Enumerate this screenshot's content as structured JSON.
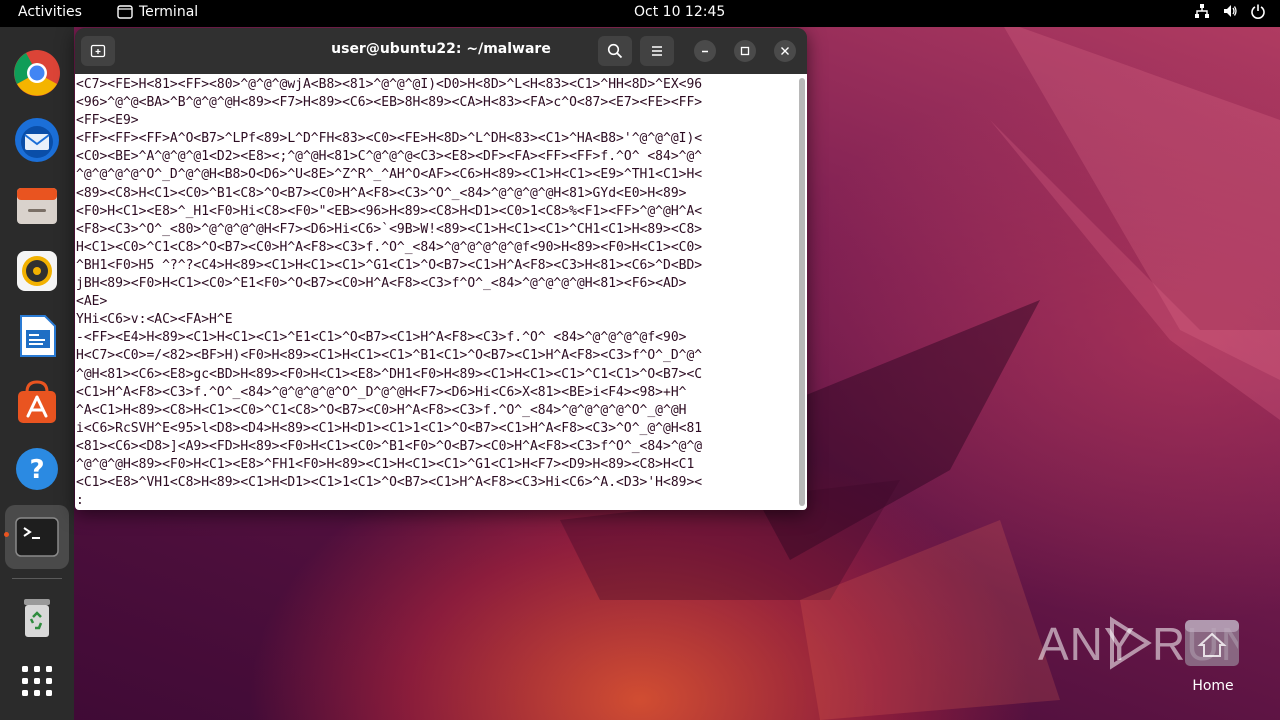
{
  "topbar": {
    "activities": "Activities",
    "app_name": "Terminal",
    "clock": "Oct 10  12:45"
  },
  "dock": {
    "items": [
      {
        "name": "Google Chrome",
        "icon": "chrome-icon"
      },
      {
        "name": "Thunderbird Mail",
        "icon": "thunderbird-icon"
      },
      {
        "name": "Files",
        "icon": "files-icon"
      },
      {
        "name": "Rhythmbox",
        "icon": "rhythmbox-icon"
      },
      {
        "name": "LibreOffice Writer",
        "icon": "writer-icon"
      },
      {
        "name": "Ubuntu Software",
        "icon": "software-icon"
      },
      {
        "name": "Help",
        "icon": "help-icon"
      },
      {
        "name": "Terminal",
        "icon": "terminal-icon",
        "running": true
      },
      {
        "name": "Trash",
        "icon": "trash-icon"
      },
      {
        "name": "Show Applications",
        "icon": "app-grid-icon"
      }
    ]
  },
  "terminal": {
    "title": "user@ubuntu22: ~/malware",
    "lines": [
      "<C7><FE>H<81><FF><80>^@^@^@wjA<B8><81>^@^@^@I)<D0>H<8D>^L<H<83><C1>^HH<8D>^EX<96",
      "<96>^@^@<BA>^B^@^@^@H<89><F7>H<89><C6><EB>8H<89><CA>H<83><FA>c^O<87><E7><FE><FF>",
      "<FF><E9>",
      "<FF><FF><FF>A^O<B7>^LPf<89>L^D^FH<83><C0><FE>H<8D>^L^DH<83><C1>^HA<B8>'^@^@^@I)<",
      "<C0><BE>^A^@^@^@1<D2><E8><;^@^@H<81>C^@^@^@<C3><E8><DF><FA><FF><FF>f.^O^ <84>^@^",
      "^@^@^@^@^O^_D^@^@H<B8>O<D6>^U<8E>^Z^R^_^AH^O<AF><C6>H<89><C1>H<C1><E9>^TH1<C1>H<",
      "<89><C8>H<C1><C0>^B1<C8>^O<B7><C0>H^A<F8><C3>^O^_<84>^@^@^@^@H<81>GYd<E0>H<89>",
      "<F0>H<C1><E8>^_H1<F0>Hi<C8><F0>\"<EB><96>H<89><C8>H<D1><C0>1<C8>%<F1><FF>^@^@H^A<",
      "<F8><C3>^O^_<80>^@^@^@^@H<F7><D6>Hi<C6>`<9B>W!<89><C1>H<C1><C1>^CH1<C1>H<89><C8>",
      "H<C1><C0>^C1<C8>^O<B7><C0>H^A<F8><C3>f.^O^_<84>^@^@^@^@^@f<90>H<89><F0>H<C1><C0>",
      "^BH1<F0>H5 ^?^?<C4>H<89><C1>H<C1><C1>^G1<C1>^O<B7><C1>H^A<F8><C3>H<81><C6>^D<BD>",
      "jBH<89><F0>H<C1><C0>^E1<F0>^O<B7><C0>H^A<F8><C3>f^O^_<84>^@^@^@^@H<81><F6><AD>",
      "<AE>",
      "YHi<C6>v:<AC><FA>H^E",
      "-<FF><E4>H<89><C1>H<C1><C1>^E1<C1>^O<B7><C1>H^A<F8><C3>f.^O^ <84>^@^@^@^@f<90>",
      "H<C7><C0>=/<82><BF>H)<F0>H<89><C1>H<C1><C1>^B1<C1>^O<B7><C1>H^A<F8><C3>f^O^_D^@^",
      "^@H<81><C6><E8>gc<BD>H<89><F0>H<C1><E8>^DH1<F0>H<89><C1>H<C1><C1>^C1<C1>^O<B7><C",
      "<C1>H^A<F8><C3>f.^O^_<84>^@^@^@^@^O^_D^@^@H<F7><D6>Hi<C6>X<81><BE>i<F4><98>+H^",
      "^A<C1>H<89><C8>H<C1><C0>^C1<C8>^O<B7><C0>H^A<F8><C3>f.^O^_<84>^@^@^@^@^O^_@^@H",
      "i<C6>RcSVH^E<95>l<D8><D4>H<89><C1>H<D1><C1>1<C1>^O<B7><C1>H^A<F8><C3>^O^_@^@H<81",
      "<81><C6><D8>]<A9><FD>H<89><F0>H<C1><C0>^B1<F0>^O<B7><C0>H^A<F8><C3>f^O^_<84>^@^@",
      "^@^@^@H<89><F0>H<C1><E8>^FH1<F0>H<89><C1>H<C1><C1>^G1<C1>H<F7><D9>H<89><C8>H<C1",
      "<C1><E8>^VH1<C8>H<89><C1>H<D1><C1>1<C1>^O<B7><C1>H^A<F8><C3>Hi<C6>^A.<D3>'H<89><",
      ":"
    ]
  },
  "desktop": {
    "home_label": "Home",
    "watermark": "ANY RUN"
  }
}
